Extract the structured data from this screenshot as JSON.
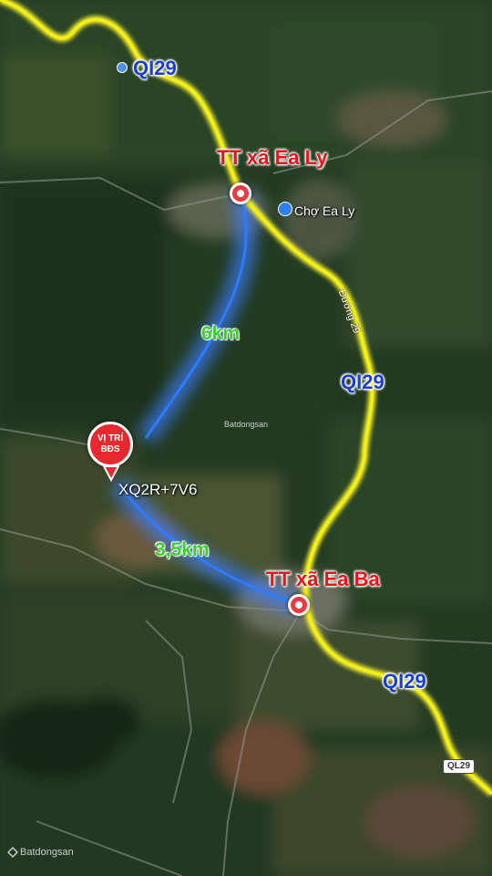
{
  "labels": {
    "ql_1": "QI29",
    "ql_2": "QI29",
    "ql_3": "QI29",
    "shield": "QL29",
    "town_north": "TT xã Ea Ly",
    "town_south": "TT xã Ea Ba",
    "dist_north": "6km",
    "dist_south": "3,5km",
    "plus_code": "XQ2R+7V6",
    "market": "Chợ Ea Ly",
    "road_name": "Đường 29",
    "watermark_1": "Batdongsan",
    "watermark_2": "Batdongsan"
  },
  "badge": {
    "line1": "VỊ TRÍ",
    "line2": "BĐS"
  },
  "colors": {
    "highway": "#f2ee1a",
    "route": "#2e7bff",
    "town": "#e8141c",
    "distance": "#3bd12b",
    "ql": "#1a3fd0"
  }
}
